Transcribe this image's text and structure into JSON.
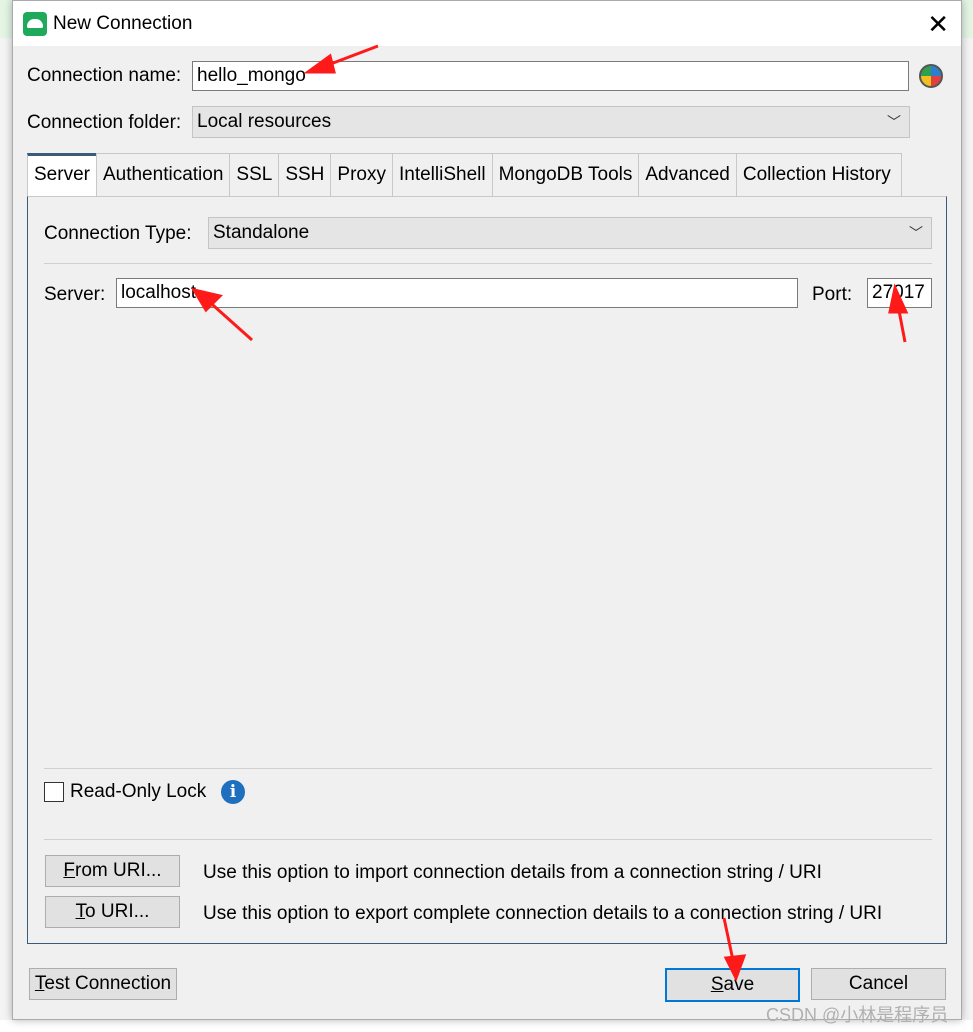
{
  "dialog": {
    "title": "New Connection"
  },
  "form": {
    "connection_name_label": "Connection name:",
    "connection_name_value": "hello_mongo",
    "connection_folder_label": "Connection folder:",
    "connection_folder_value": "Local resources"
  },
  "tabs": [
    {
      "label": "Server",
      "active": true
    },
    {
      "label": "Authentication"
    },
    {
      "label": "SSL"
    },
    {
      "label": "SSH"
    },
    {
      "label": "Proxy"
    },
    {
      "label": "IntelliShell"
    },
    {
      "label": "MongoDB Tools"
    },
    {
      "label": "Advanced"
    },
    {
      "label": "Collection History"
    }
  ],
  "server": {
    "connection_type_label": "Connection Type:",
    "connection_type_value": "Standalone",
    "server_label": "Server:",
    "server_value": "localhost",
    "port_label": "Port:",
    "port_value": "27017",
    "readonly_label": "Read-Only Lock",
    "readonly_checked": false,
    "from_uri_key": "F",
    "from_uri_rest": "rom URI...",
    "from_uri_desc": "Use this option to import connection details from a connection string / URI",
    "to_uri_key": "T",
    "to_uri_rest": "o URI...",
    "to_uri_desc": "Use this option to export complete connection details to a connection string / URI"
  },
  "footer": {
    "test_key": "T",
    "test_rest": "est Connection",
    "save_key": "S",
    "save_rest": "ave",
    "cancel": "Cancel"
  },
  "watermark": "CSDN @小林是程序员",
  "colors": {
    "accent": "#0078d7",
    "tab_accent": "#3c5a7a",
    "annotation": "#ff1a1a"
  }
}
